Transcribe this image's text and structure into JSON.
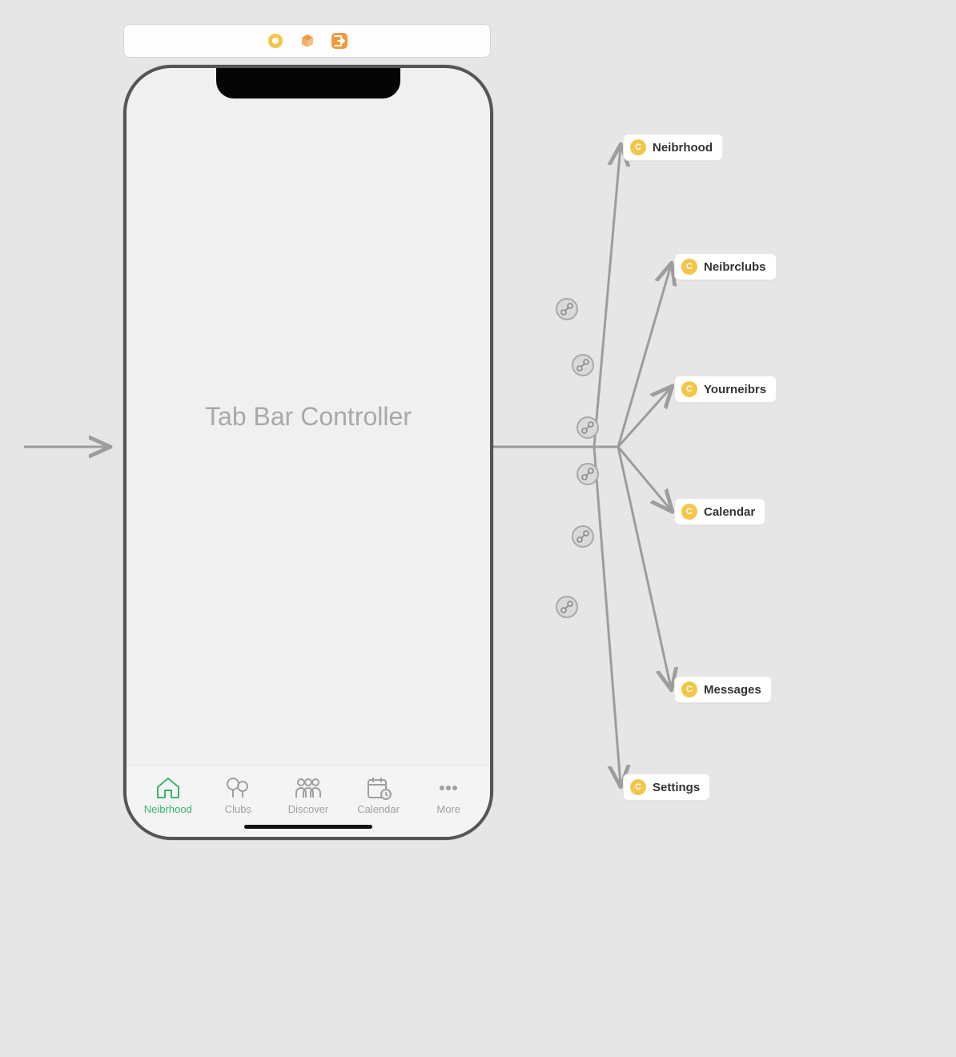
{
  "title": "Tab Bar Controller",
  "toolbar": {
    "icons": [
      "controller-circle-icon",
      "object-cube-icon",
      "segue-exit-icon"
    ]
  },
  "tabs": [
    {
      "label": "Neibrhood",
      "icon": "house-icon",
      "active": true
    },
    {
      "label": "Clubs",
      "icon": "tree-icon",
      "active": false
    },
    {
      "label": "Discover",
      "icon": "people-icon",
      "active": false
    },
    {
      "label": "Calendar",
      "icon": "calendar-icon",
      "active": false
    },
    {
      "label": "More",
      "icon": "dots-icon",
      "active": false
    }
  ],
  "destinations": [
    {
      "label": "Neibrhood"
    },
    {
      "label": "Neibrclubs"
    },
    {
      "label": "Yourneibrs"
    },
    {
      "label": "Calendar"
    },
    {
      "label": "Messages"
    },
    {
      "label": "Settings"
    }
  ],
  "colors": {
    "active": "#35b768",
    "inactive": "#a0a0a0",
    "nodeYellow": "#F3C64A",
    "toolbarOrange": "#ED9B40",
    "edge": "#9d9d9d"
  }
}
